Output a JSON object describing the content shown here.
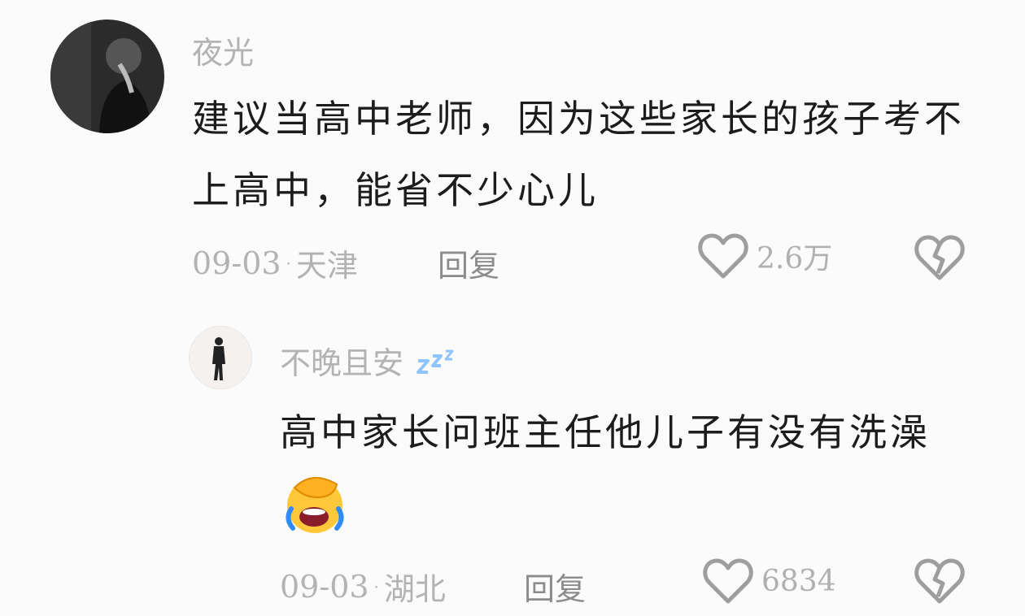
{
  "comments": [
    {
      "username": "夜光",
      "content": "建议当高中老师，因为这些家长的孩子考不上高中，能省不少心儿",
      "date": "09-03",
      "location": "天津",
      "reply_label": "回复",
      "like_count": "2.6万"
    },
    {
      "username": "不晚且安",
      "username_badge": "zzz",
      "content": "高中家长问班主任他儿子有没有洗澡",
      "content_emoji": "facepalm-laughing-emoji",
      "date": "09-03",
      "location": "湖北",
      "reply_label": "回复",
      "like_count": "6834"
    }
  ],
  "colors": {
    "background": "#fbfbfb",
    "meta_text": "#b3b3b3",
    "reply_text": "#8c8c8c",
    "content_text": "#1c1c1c",
    "icon": "#9e9e9e",
    "sleep_badge": "#8ec5ff"
  }
}
